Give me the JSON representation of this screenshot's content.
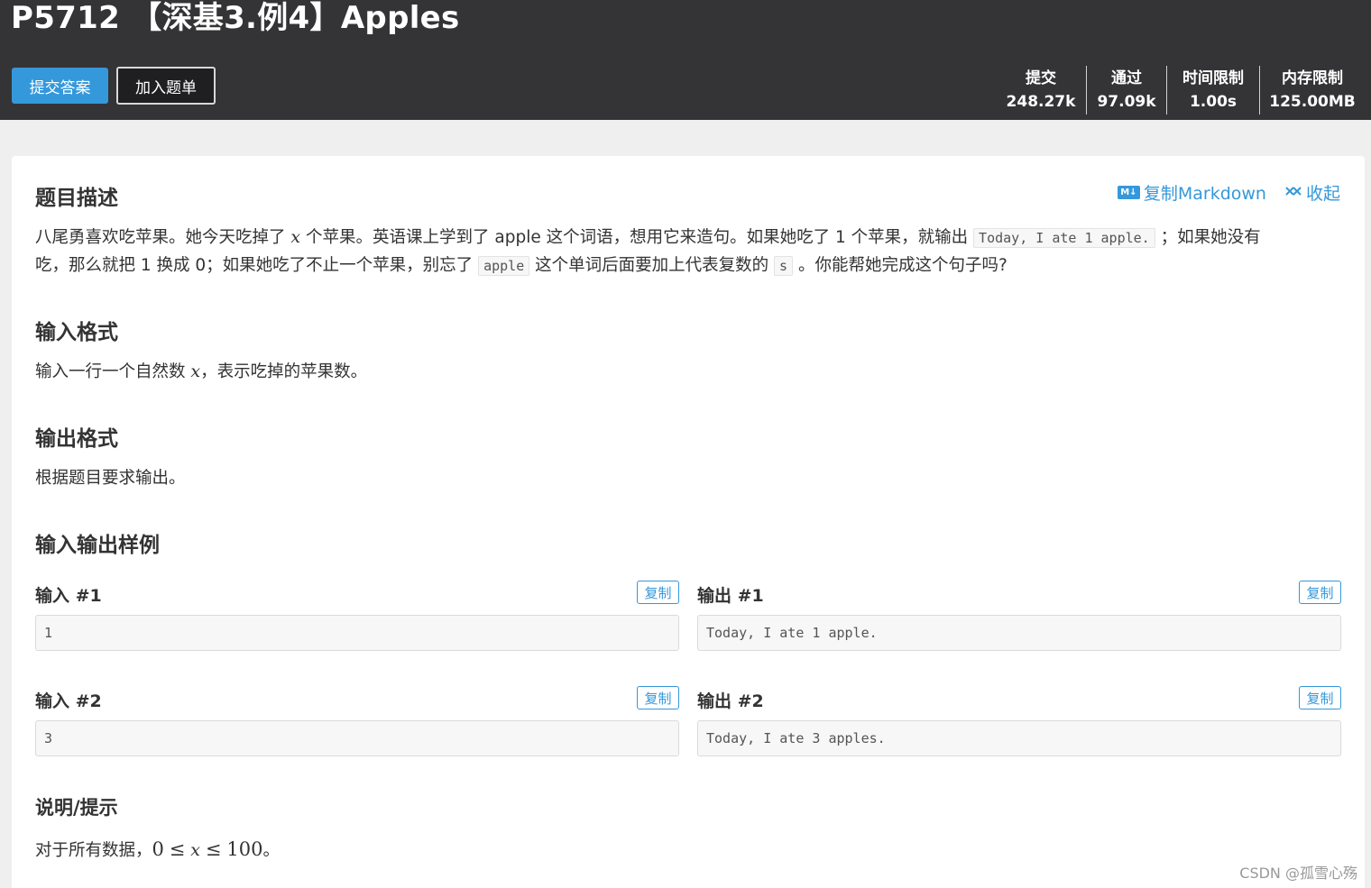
{
  "header": {
    "title": "P5712 【深基3.例4】Apples",
    "submit_label": "提交答案",
    "add_list_label": "加入题单",
    "stats": [
      {
        "label": "提交",
        "value": "248.27k"
      },
      {
        "label": "通过",
        "value": "97.09k"
      },
      {
        "label": "时间限制",
        "value": "1.00s"
      },
      {
        "label": "内存限制",
        "value": "125.00MB"
      }
    ]
  },
  "toolbar": {
    "md_badge": "M↓",
    "copy_markdown": "复制Markdown",
    "collapse": "收起"
  },
  "description": {
    "heading": "题目描述",
    "line1_a": "八尾勇喜欢吃苹果。她今天吃掉了",
    "var_x": "x",
    "line1_b": "个苹果。英语课上学到了 apple 这个词语，想用它来造句。如果她吃了 1 个苹果，就输出",
    "code_today": "Today, I ate 1 apple.",
    "line1_c": "；如果她没有",
    "line2_a": "吃，那么就把 1 换成 0；如果她吃了不止一个苹果，别忘了",
    "code_apple": "apple",
    "line2_b": "这个单词后面要加上代表复数的",
    "code_s": "s",
    "line2_c": "。你能帮她完成这个句子吗?"
  },
  "input_format": {
    "heading": "输入格式",
    "text_a": "输入一行一个自然数",
    "var_x": "x",
    "text_b": "，表示吃掉的苹果数。"
  },
  "output_format": {
    "heading": "输出格式",
    "text": "根据题目要求输出。"
  },
  "samples": {
    "heading": "输入输出样例",
    "copy_label": "复制",
    "items": [
      {
        "in_label": "输入 #1",
        "in_value": "1",
        "out_label": "输出 #1",
        "out_value": "Today, I ate 1 apple."
      },
      {
        "in_label": "输入 #2",
        "in_value": "3",
        "out_label": "输出 #2",
        "out_value": "Today, I ate 3 apples."
      }
    ]
  },
  "hint": {
    "heading": "说明/提示",
    "text_a": "对于所有数据，",
    "num_0": "0",
    "le1": "≤",
    "var_x": "x",
    "le2": "≤",
    "num_100": "100",
    "text_b": "。"
  },
  "watermark": "CSDN @孤雪心殇"
}
